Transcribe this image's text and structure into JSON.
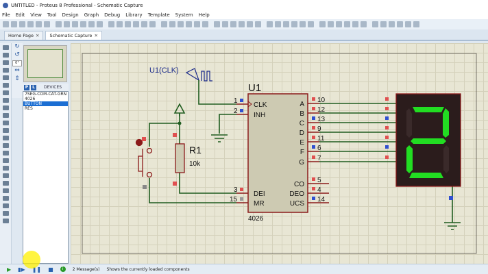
{
  "window": {
    "title": "UNTITLED - Proteus 8 Professional - Schematic Capture"
  },
  "menu": [
    "File",
    "Edit",
    "View",
    "Tool",
    "Design",
    "Graph",
    "Debug",
    "Library",
    "Template",
    "System",
    "Help"
  ],
  "tabs": [
    {
      "label": "Home Page",
      "active": false
    },
    {
      "label": "Schematic Capture",
      "active": true
    }
  ],
  "rotation": {
    "value": "0°"
  },
  "devices": {
    "header": "DEVICES",
    "p_label": "P",
    "l_label": "L",
    "items": [
      {
        "label": "7SEG-COM-CAT-GRN",
        "selected": false
      },
      {
        "label": "4026",
        "selected": false
      },
      {
        "label": "BUTTON",
        "selected": true
      },
      {
        "label": "RES",
        "selected": false
      }
    ]
  },
  "schematic": {
    "u1": {
      "ref": "U1",
      "part": "4026",
      "left_pins": [
        {
          "num": "1",
          "name": "CLK"
        },
        {
          "num": "2",
          "name": "INH"
        },
        {
          "num": "3",
          "name": "DEI"
        },
        {
          "num": "15",
          "name": "MR"
        }
      ],
      "right_pins": [
        {
          "num": "10",
          "name": "A"
        },
        {
          "num": "12",
          "name": "B"
        },
        {
          "num": "13",
          "name": "C"
        },
        {
          "num": "9",
          "name": "D"
        },
        {
          "num": "11",
          "name": "E"
        },
        {
          "num": "6",
          "name": "F"
        },
        {
          "num": "7",
          "name": "G"
        },
        {
          "num": "5",
          "name": "CO"
        },
        {
          "num": "4",
          "name": "DEO"
        },
        {
          "num": "14",
          "name": "UCS"
        }
      ]
    },
    "clock": {
      "label": "U1(CLK)"
    },
    "r1": {
      "ref": "R1",
      "value": "10k"
    },
    "display": {
      "digit": "2",
      "segment_color": "#22dd22"
    },
    "colors": {
      "wire": "#1f5c1f",
      "component": "#8b1a1a",
      "label_blue": "#1a2a8a"
    }
  },
  "status": {
    "messages": "2 Message(s)",
    "hint": "Shows the currently loaded components"
  }
}
